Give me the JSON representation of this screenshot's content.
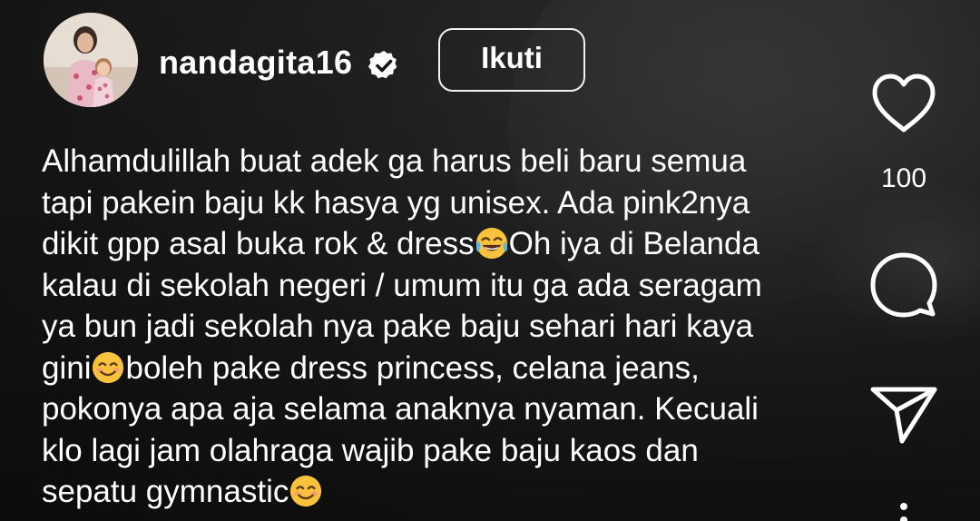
{
  "post": {
    "username": "nandagita16",
    "verified": true,
    "follow_label": "Ikuti",
    "caption_lines": [
      "Alhamdulillah buat adek ga harus beli baru semua",
      "tapi pakein baju kk hasya yg unisex. Ada pink2nya",
      "dikit gpp asal buka rok & dress",
      "Oh iya di Belanda",
      "kalau di sekolah negeri / umum itu ga ada seragam",
      "ya bun jadi sekolah nya pake baju sehari hari kaya",
      "gini",
      "boleh pake dress princess, celana jeans,",
      "pokonya apa aja selama anaknya nyaman. Kecuali",
      "klo lagi jam olahraga wajib pake baju kaos dan",
      "sepatu gymnastic"
    ],
    "emojis": [
      "face-with-tears-of-joy",
      "smiling-face-with-smiling-eyes",
      "smiling-face-with-smiling-eyes"
    ]
  },
  "actions": {
    "like_icon": "heart-icon",
    "like_count": "100",
    "comment_icon": "comment-icon",
    "share_icon": "send-icon",
    "more_icon": "more-dots-icon"
  },
  "colors": {
    "text": "#ffffff",
    "background": "#1c1c1c",
    "verified_badge": "#ffffff",
    "emoji_yellow": "#f9c23c"
  }
}
